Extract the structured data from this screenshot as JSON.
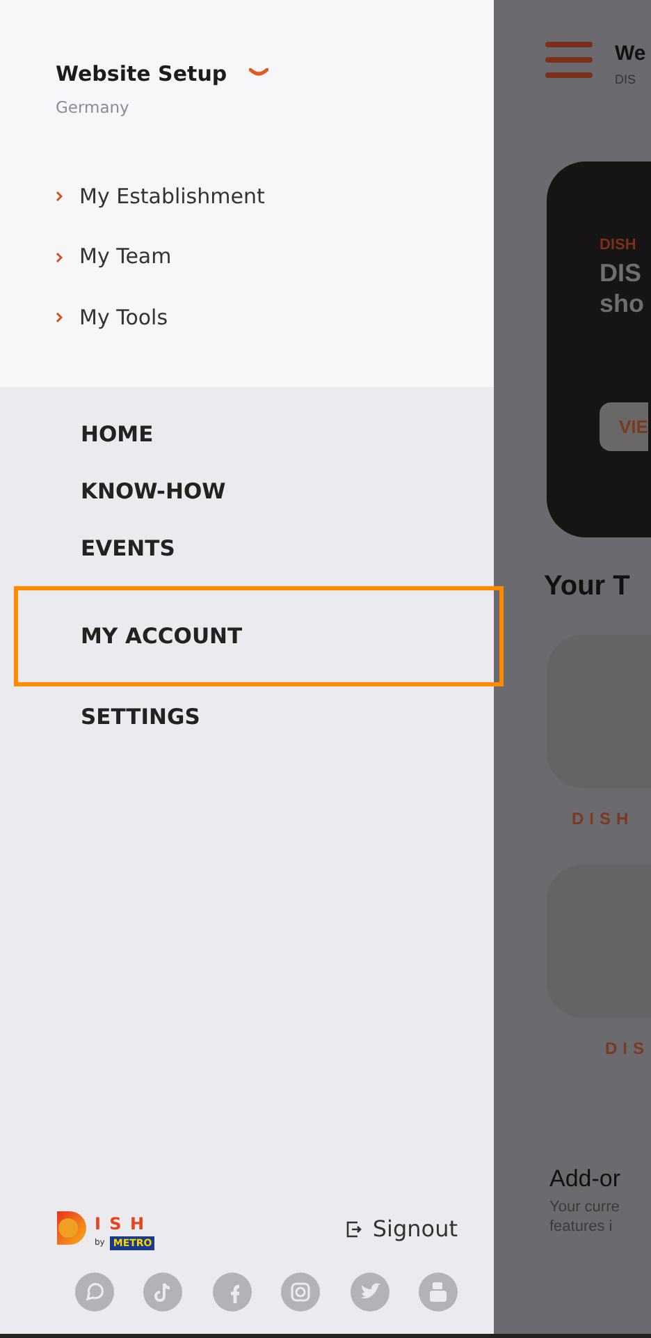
{
  "drawer": {
    "title": "Website Setup",
    "subtitle": "Germany",
    "expanded": true,
    "submenu": [
      "My Establishment",
      "My Team",
      "My Tools"
    ],
    "menu": [
      {
        "label": "HOME",
        "highlighted": false
      },
      {
        "label": "KNOW-HOW",
        "highlighted": false
      },
      {
        "label": "EVENTS",
        "highlighted": false
      },
      {
        "label": "MY ACCOUNT",
        "highlighted": true
      },
      {
        "label": "SETTINGS",
        "highlighted": false
      }
    ],
    "logo": {
      "letters": "I S H",
      "by": "by",
      "brand": "METRO"
    },
    "signout": "Signout",
    "social": [
      {
        "kind": "whatsapp"
      },
      {
        "kind": "tiktok"
      },
      {
        "kind": "facebook"
      },
      {
        "kind": "instagram"
      },
      {
        "kind": "twitter"
      },
      {
        "kind": "youtube"
      }
    ]
  },
  "background": {
    "title": "We",
    "subtitle": "DIS",
    "banner": {
      "tag": "DISH",
      "headline": [
        "DIS",
        "sho"
      ],
      "button": "VIE"
    },
    "section_title": "Your T",
    "tiles": [
      "DISH",
      "DIS"
    ],
    "addons": {
      "title": "Add-or",
      "text": [
        "Your curre",
        "features i"
      ]
    }
  }
}
